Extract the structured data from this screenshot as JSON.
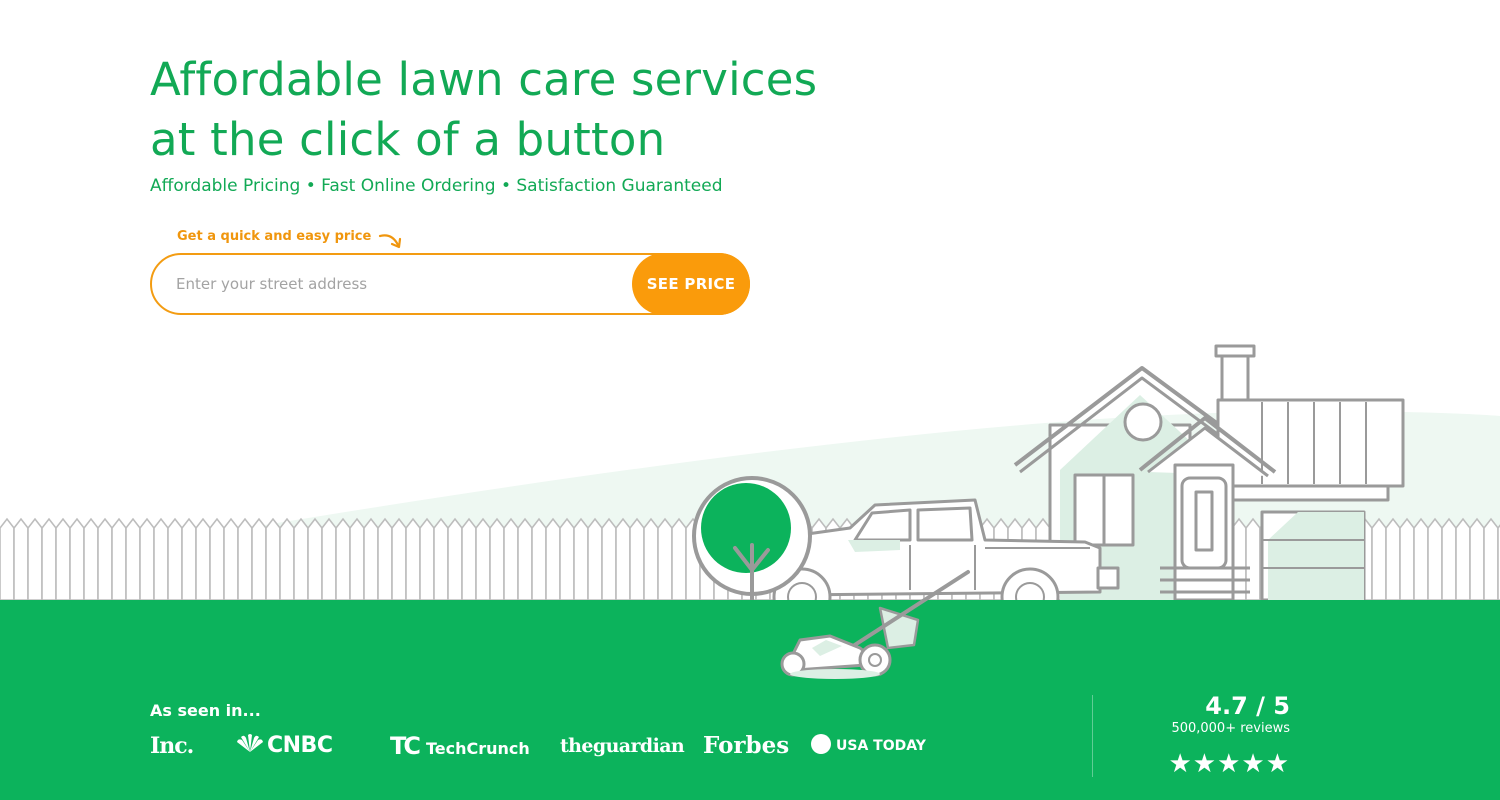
{
  "hero": {
    "title_line1": "Affordable lawn care services",
    "title_line2": "at the click of a button",
    "subtitle": "Affordable Pricing • Fast Online Ordering • Satisfaction Guaranteed"
  },
  "quote": {
    "hint": "Get a quick and easy price",
    "address_placeholder": "Enter your street address",
    "address_value": "",
    "button_label": "SEE PRICE"
  },
  "press": {
    "heading": "As seen in...",
    "logos": [
      "Inc.",
      "CNBC",
      "TechCrunch",
      "theguardian",
      "Forbes",
      "USA TODAY"
    ]
  },
  "rating": {
    "score": "4.7 / 5",
    "reviews": "500,000+ reviews",
    "stars": "★★★★★"
  },
  "colors": {
    "brand_green": "#12a955",
    "lawn_green": "#0cb35c",
    "accent_orange": "#fa9b0b",
    "line_gray": "#999999"
  },
  "icons": [
    "curved-arrow-icon",
    "peacock-icon",
    "star-icon"
  ]
}
